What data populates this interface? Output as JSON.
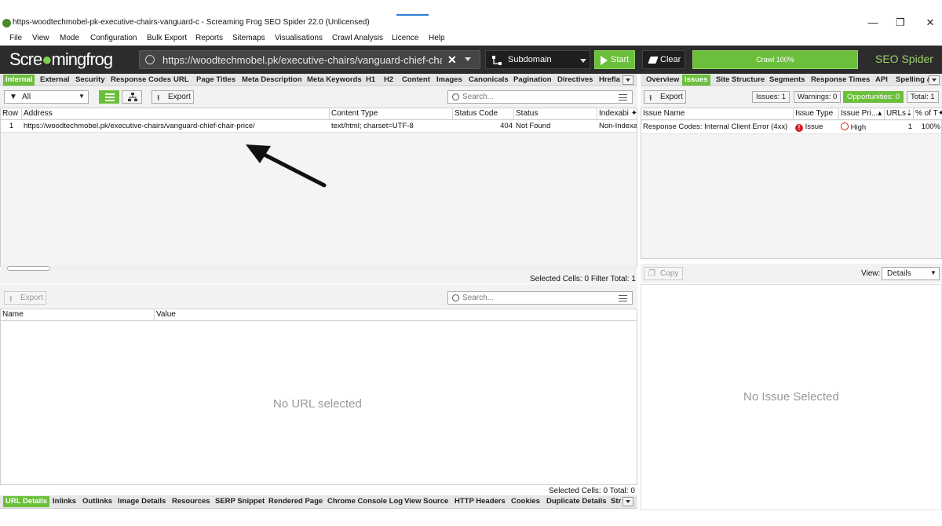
{
  "window": {
    "title": "https-woodtechmobel-pk-executive-chairs-vanguard-c - Screaming Frog SEO Spider 22.0 (Unlicensed)",
    "controls": [
      "—",
      "❐",
      "✕"
    ]
  },
  "menu": [
    "File",
    "View",
    "Mode",
    "Configuration",
    "Bulk Export",
    "Reports",
    "Sitemaps",
    "Visualisations",
    "Crawl Analysis",
    "Licence",
    "Help"
  ],
  "toolbar": {
    "brand_a": "Scre",
    "brand_b": "mingfrog",
    "url": "https://woodtechmobel.pk/executive-chairs/vanguard-chief-cha",
    "mode": "Subdomain",
    "start": "Start",
    "clear": "Clear",
    "progress": "Crawl 100%",
    "progress_value": 100,
    "product": "SEO Spider"
  },
  "top_tabs": [
    "Internal",
    "External",
    "Security",
    "Response Codes",
    "URL",
    "Page Titles",
    "Meta Description",
    "Meta Keywords",
    "H1",
    "H2",
    "Content",
    "Images",
    "Canonicals",
    "Pagination",
    "Directives",
    "Hrefla"
  ],
  "filter": {
    "value": "All",
    "export": "Export",
    "search_placeholder": "Search..."
  },
  "main_table": {
    "headers": [
      "Row",
      "Address",
      "Content Type",
      "Status Code",
      "Status",
      "Indexabi"
    ],
    "rows": [
      [
        "1",
        "https://woodtechmobel.pk/executive-chairs/vanguard-chief-chair-price/",
        "text/html; charset=UTF-8",
        "404",
        "Not Found",
        "Non-Indexa"
      ]
    ],
    "footer": "Selected Cells:  0  Filter Total:  1"
  },
  "details": {
    "export": "Export",
    "search_placeholder": "Search...",
    "headers": [
      "Name",
      "Value"
    ],
    "empty": "No URL selected",
    "footer": "Selected Cells:  0  Total:  0"
  },
  "bottom_tabs": [
    "URL Details",
    "Inlinks",
    "Outlinks",
    "Image Details",
    "Resources",
    "SERP Snippet",
    "Rendered Page",
    "Chrome Console Log",
    "View Source",
    "HTTP Headers",
    "Cookies",
    "Duplicate Details",
    "Str"
  ],
  "right_tabs": [
    "Overview",
    "Issues",
    "Site Structure",
    "Segments",
    "Response Times",
    "API",
    "Spelling &"
  ],
  "issues": {
    "export": "Export",
    "badges": [
      "Issues: 1",
      "Warnings: 0",
      "Opportunities: 0",
      "Total: 1"
    ],
    "headers": [
      "Issue Name",
      "Issue Type",
      "Issue Pri...",
      "URLs",
      "% of T"
    ],
    "rows": [
      [
        "Response Codes: Internal Client Error (4xx)",
        "Issue",
        "High",
        "1",
        "100%"
      ]
    ],
    "copy": "Copy",
    "view_label": "View:",
    "view_value": "Details",
    "empty": "No Issue Selected"
  },
  "colors": {
    "accent": "#6cbf3b",
    "toolbar": "#2c2c2c",
    "issue_red": "#d42020"
  }
}
